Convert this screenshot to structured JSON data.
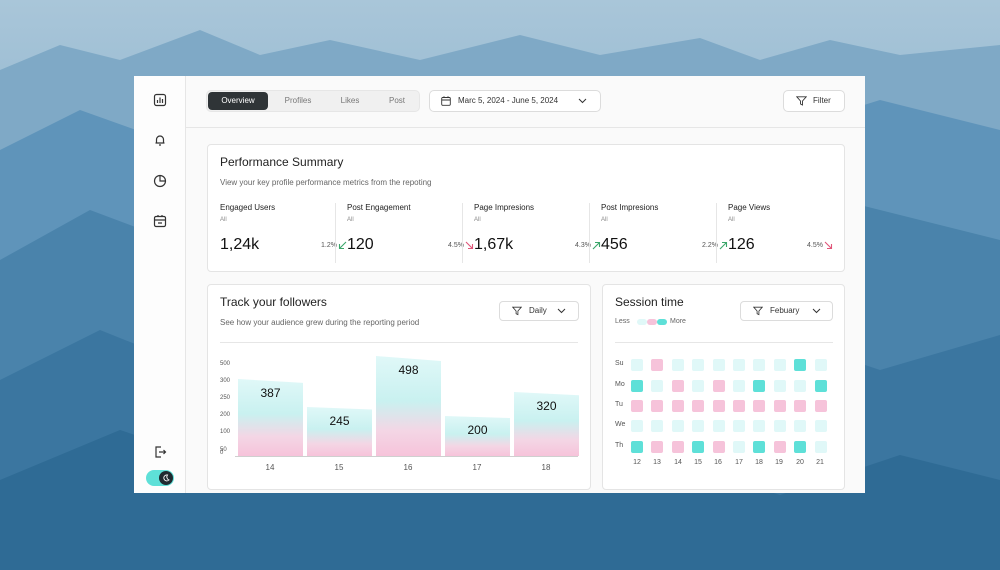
{
  "colors": {
    "teal": "#5ee0d8",
    "teal_light": "#e0f8f8",
    "pink": "#f6c3da",
    "dark": "#2f3437"
  },
  "sidebar": {
    "icons": [
      "bar-chart-icon",
      "bell-icon",
      "pie-chart-icon",
      "calendar-icon"
    ],
    "logout_icon": "logout-icon",
    "toggle_icon": "moon-icon"
  },
  "topbar": {
    "tabs": [
      {
        "label": "Overview",
        "active": true
      },
      {
        "label": "Profiles",
        "active": false
      },
      {
        "label": "Likes",
        "active": false
      },
      {
        "label": "Post",
        "active": false
      }
    ],
    "date_range": "Marc 5, 2024 - June 5, 2024",
    "filter_label": "Filter"
  },
  "summary": {
    "title": "Performance Summary",
    "subtitle": "View your key profile performance metrics from the repoting",
    "metrics": [
      {
        "label": "Engaged Users",
        "scope": "All",
        "value": "1,24k",
        "change": "1.2%",
        "direction": "down",
        "color": "#3aa66a"
      },
      {
        "label": "Post Engagement",
        "scope": "All",
        "value": "120",
        "change": "4.5%",
        "direction": "down",
        "color": "#e0567a"
      },
      {
        "label": "Page Impresions",
        "scope": "All",
        "value": "1,67k",
        "change": "4.3%",
        "direction": "up",
        "color": "#3aa66a"
      },
      {
        "label": "Post Impresions",
        "scope": "All",
        "value": "456",
        "change": "2.2%",
        "direction": "up",
        "color": "#3aa66a"
      },
      {
        "label": "Page Views",
        "scope": "All",
        "value": "126",
        "change": "4.5%",
        "direction": "down",
        "color": "#e0567a"
      }
    ]
  },
  "followers": {
    "title": "Track your followers",
    "subtitle": "See how your audience grew during the reporting period",
    "dropdown": "Daily",
    "y_ticks": [
      "500",
      "300",
      "250",
      "200",
      "100",
      "50",
      "0"
    ]
  },
  "session": {
    "title": "Session time",
    "legend_less": "Less",
    "legend_more": "More",
    "dropdown": "Febuary",
    "days": [
      "Su",
      "Mo",
      "Tu",
      "We",
      "Th"
    ],
    "x_labels": [
      "12",
      "13",
      "14",
      "15",
      "16",
      "17",
      "18",
      "19",
      "20",
      "21"
    ],
    "levels": [
      [
        0,
        2,
        0,
        0,
        0,
        0,
        0,
        0,
        3,
        0
      ],
      [
        3,
        1,
        2,
        0,
        2,
        1,
        3,
        1,
        1,
        3
      ],
      [
        2,
        2,
        2,
        2,
        2,
        2,
        2,
        2,
        2,
        2
      ],
      [
        1,
        1,
        1,
        1,
        1,
        1,
        1,
        1,
        1,
        1
      ],
      [
        3,
        2,
        2,
        3,
        2,
        1,
        3,
        2,
        3,
        1
      ]
    ]
  },
  "chart_data": {
    "type": "bar",
    "categories": [
      "14",
      "15",
      "16",
      "17",
      "18"
    ],
    "values": [
      387,
      245,
      498,
      200,
      320
    ],
    "title": "Track your followers",
    "xlabel": "",
    "ylabel": "",
    "ylim": [
      0,
      500
    ]
  }
}
